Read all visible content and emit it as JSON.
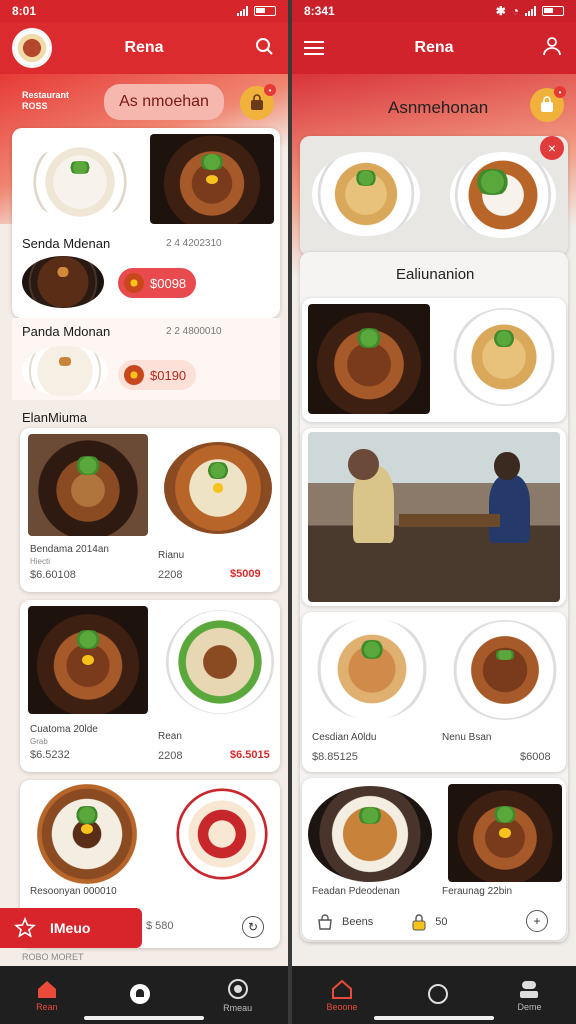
{
  "left": {
    "status": {
      "time": "8:01"
    },
    "appbar": {
      "title": "Rena"
    },
    "subheader": {
      "line1": "Restaurant",
      "line2": "ROSS"
    },
    "search_pill": "As nmoehan",
    "featured": {
      "item1": {
        "name": "Senda Mdenan",
        "code": "2 4 4202310",
        "price": "$0098"
      },
      "item2": {
        "name": "Panda Mdonan",
        "code": "2 2 4800010",
        "price": "$0190"
      }
    },
    "section_label": "ElanMiuma",
    "grid1": {
      "left": {
        "name": "Bendama 2014an",
        "sub": "Hiecti",
        "price": "$6.60108"
      },
      "right": {
        "name": "Rianu",
        "sub": "2208",
        "price": "$5009"
      }
    },
    "grid2": {
      "left": {
        "name": "Cuatoma 20lde",
        "sub": "Grab",
        "price": "$6.5232"
      },
      "right": {
        "name": "Rean",
        "sub": "2208",
        "price": "$6.5015"
      }
    },
    "grid3": {
      "left": {
        "name": "Resoonyan 000010"
      },
      "cta_label": "IMeuo",
      "price": "$ 580"
    },
    "footer_text": "ROBO MORET",
    "nav": [
      {
        "label": "Rean",
        "icon": "home-icon"
      },
      {
        "label": "",
        "icon": "chef-hat-icon"
      },
      {
        "label": "Rmeau",
        "icon": "dish-icon"
      }
    ]
  },
  "right": {
    "status": {
      "time": "8:341"
    },
    "appbar": {
      "title": "Rena"
    },
    "search_pill": "Asnmehonan",
    "section_title": "Ealiunanion",
    "card_grid1": {
      "left": {
        "name": "Cesdian A0ldu",
        "price": "$8.85125"
      },
      "right": {
        "name": "Nenu Bsan",
        "price": "$6008"
      }
    },
    "card_grid2": {
      "left": {
        "name": "Feadan Pdeodenan"
      },
      "right": {
        "name": "Feraunag 22bin"
      }
    },
    "action_row": {
      "label1": "Beens",
      "label2": "50"
    },
    "nav": [
      {
        "label": "Beoone",
        "icon": "home-icon"
      },
      {
        "label": "",
        "icon": "circle-icon"
      },
      {
        "label": "Deme",
        "icon": "profile-icon"
      }
    ]
  }
}
